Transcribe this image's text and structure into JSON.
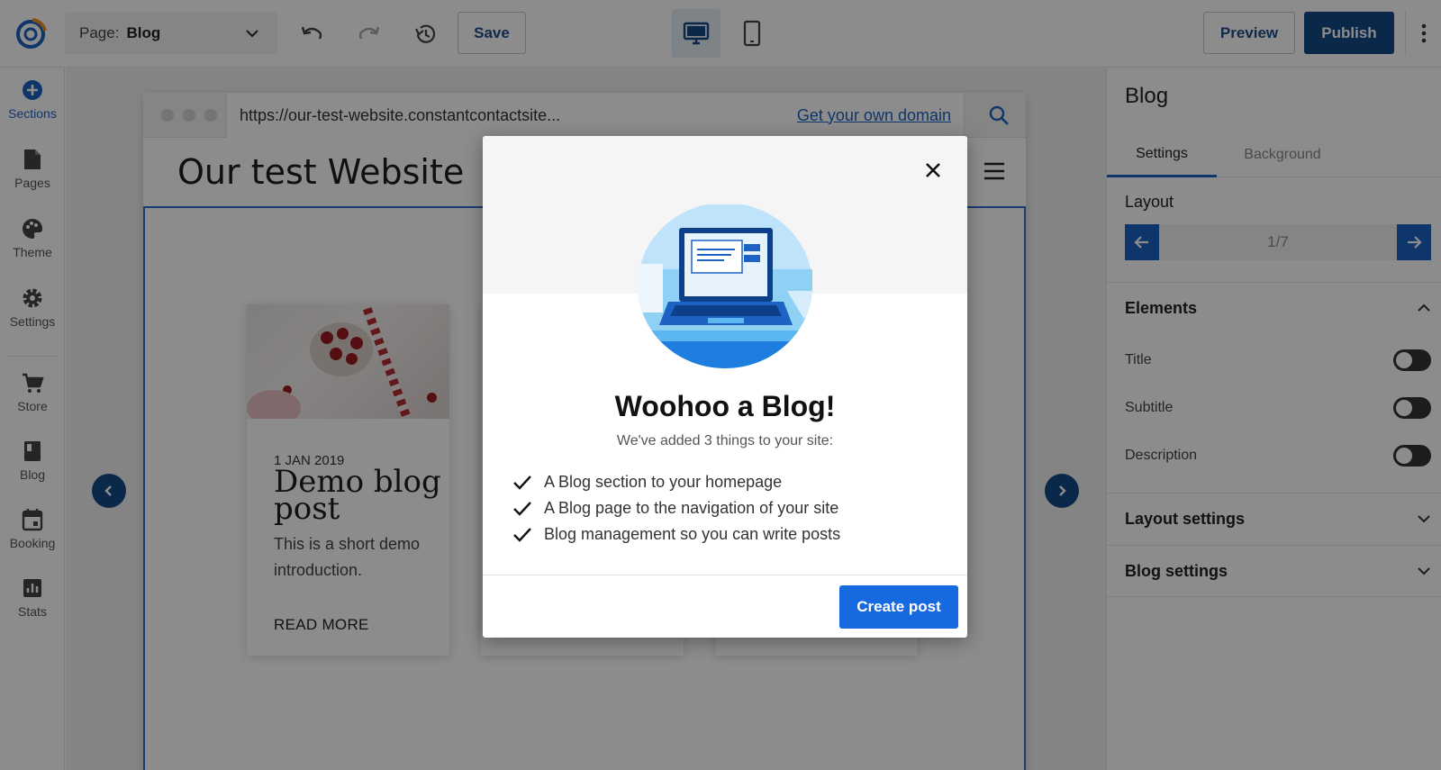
{
  "topbar": {
    "page_label": "Page:",
    "page_value": "Blog",
    "save_label": "Save",
    "preview_label": "Preview",
    "publish_label": "Publish"
  },
  "leftrail": {
    "items": [
      {
        "label": "Sections",
        "icon": "plus-circle-icon"
      },
      {
        "label": "Pages",
        "icon": "page-icon"
      },
      {
        "label": "Theme",
        "icon": "palette-icon"
      },
      {
        "label": "Settings",
        "icon": "gear-icon"
      },
      {
        "label": "Store",
        "icon": "cart-icon"
      },
      {
        "label": "Blog",
        "icon": "book-icon"
      },
      {
        "label": "Booking",
        "icon": "calendar-icon"
      },
      {
        "label": "Stats",
        "icon": "stats-icon"
      }
    ]
  },
  "canvas": {
    "url": "https://our-test-website.constantcontactsite...",
    "domain_link": "Get your own domain",
    "site_title": "Our test Website",
    "card": {
      "date": "1 JAN 2019",
      "title": "Demo blog post",
      "description": "This is a short demo introduction.",
      "read_more": "READ MORE"
    }
  },
  "rightpanel": {
    "title": "Blog",
    "tabs": [
      "Settings",
      "Background"
    ],
    "layout_label": "Layout",
    "layout_counter": "1/7",
    "elements_label": "Elements",
    "toggles": [
      "Title",
      "Subtitle",
      "Description"
    ],
    "layout_settings_label": "Layout settings",
    "blog_settings_label": "Blog settings"
  },
  "modal": {
    "title": "Woohoo a Blog!",
    "subtitle": "We've added 3 things to your site:",
    "items": [
      "A Blog section to your homepage",
      "A Blog page to the navigation of your site",
      "Blog management so you can write posts"
    ],
    "create_button": "Create post"
  },
  "colors": {
    "accent": "#1769e0",
    "brand_dark": "#134a86",
    "overlay": "rgba(0,0,0,0.45)"
  }
}
